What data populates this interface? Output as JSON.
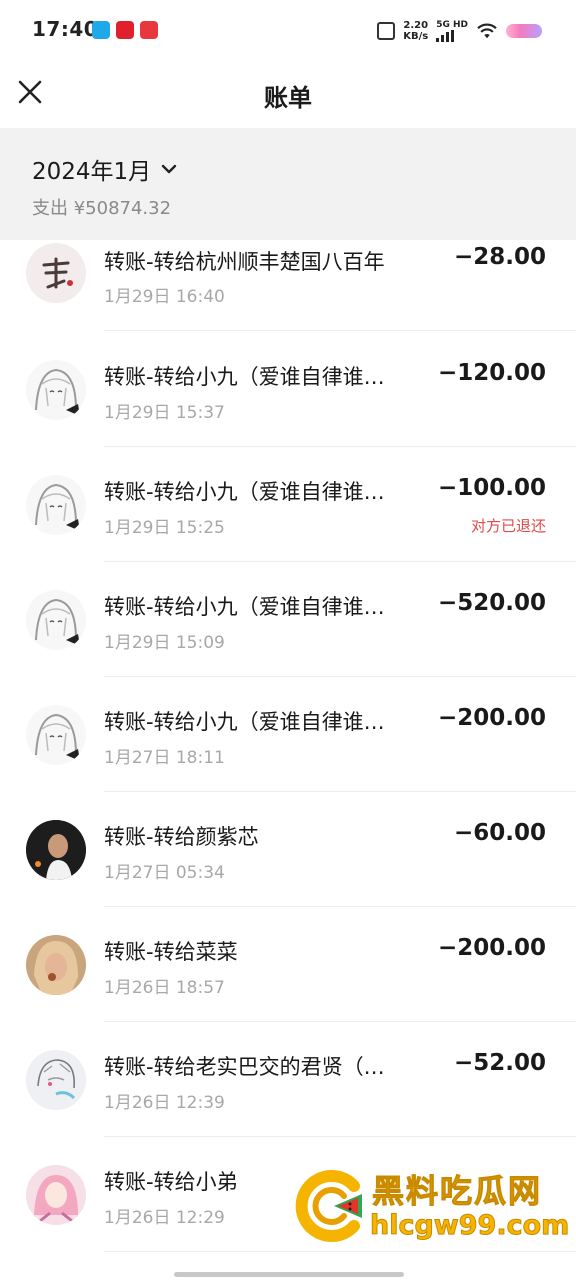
{
  "status_bar": {
    "time": "17:40",
    "net_speed_value": "2.20",
    "net_speed_unit": "KB/s",
    "network_top": "5G HD",
    "network_bottom": "",
    "icons": [
      "app-notification-icon",
      "app-notification-icon",
      "app-notification-icon",
      "vibrate-icon",
      "signal-icon",
      "wifi-icon",
      "battery-icon"
    ]
  },
  "header": {
    "title": "账单",
    "close_icon": "close-icon"
  },
  "summary": {
    "month": "2024年1月",
    "expense": "支出 ¥50874.32"
  },
  "transactions": [
    {
      "title": "转账-转给杭州顺丰楚国八百年",
      "time": "1月29日 16:40",
      "amount": "−28.00",
      "status": "",
      "avatar": "chu"
    },
    {
      "title": "转账-转给小九（爱谁自律谁…",
      "time": "1月29日 15:37",
      "amount": "−120.00",
      "status": "",
      "avatar": "anime"
    },
    {
      "title": "转账-转给小九（爱谁自律谁…",
      "time": "1月29日 15:25",
      "amount": "−100.00",
      "status": "对方已退还",
      "avatar": "anime"
    },
    {
      "title": "转账-转给小九（爱谁自律谁…",
      "time": "1月29日 15:09",
      "amount": "−520.00",
      "status": "",
      "avatar": "anime"
    },
    {
      "title": "转账-转给小九（爱谁自律谁…",
      "time": "1月27日 18:11",
      "amount": "−200.00",
      "status": "",
      "avatar": "anime"
    },
    {
      "title": "转账-转给颜紫芯",
      "time": "1月27日 05:34",
      "amount": "−60.00",
      "status": "",
      "avatar": "dark"
    },
    {
      "title": "转账-转给菜菜",
      "time": "1月26日 18:57",
      "amount": "−200.00",
      "status": "",
      "avatar": "blond"
    },
    {
      "title": "转账-转给老实巴交的君贤（…",
      "time": "1月26日 12:39",
      "amount": "−52.00",
      "status": "",
      "avatar": "sketch"
    },
    {
      "title": "转账-转给小弟",
      "time": "1月26日 12:29",
      "amount": "",
      "status": "",
      "avatar": "pink"
    }
  ],
  "watermark": {
    "name": "黑料吃瓜网",
    "url": "hlcgw99.com"
  },
  "colors": {
    "status_refunded": "#e04b4b",
    "summary_bg": "#f2f2f2",
    "watermark": "#f5b400"
  }
}
